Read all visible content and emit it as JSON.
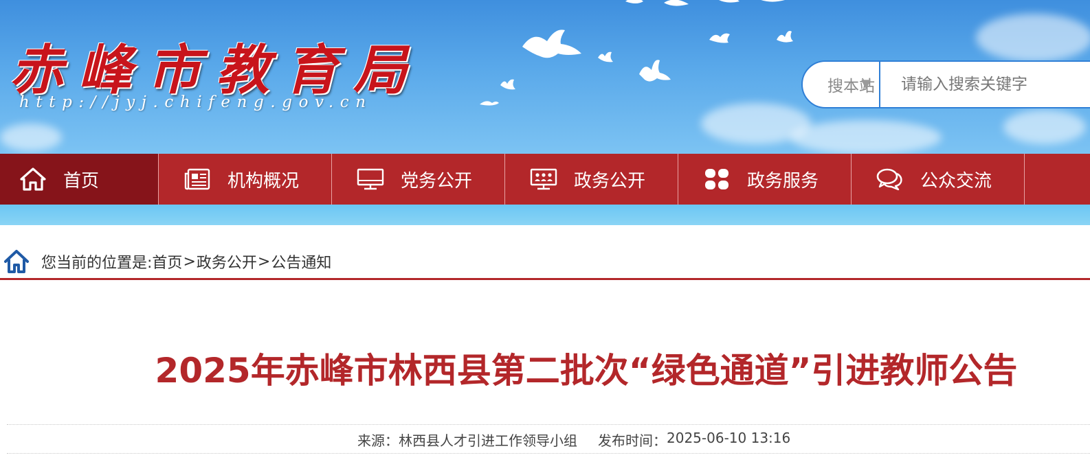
{
  "header": {
    "site_title": "赤峰市教育局",
    "site_url": "http://jyj.chifeng.gov.cn"
  },
  "search": {
    "scope_label": "搜本站",
    "placeholder": "请输入搜索关键字"
  },
  "nav": {
    "items": [
      {
        "label": "首页",
        "icon": "home-icon"
      },
      {
        "label": "机构概况",
        "icon": "newspaper-icon"
      },
      {
        "label": "党务公开",
        "icon": "monitor-icon"
      },
      {
        "label": "政务公开",
        "icon": "meeting-screen-icon"
      },
      {
        "label": "政务服务",
        "icon": "grid-icon"
      },
      {
        "label": "公众交流",
        "icon": "chat-bubbles-icon"
      }
    ]
  },
  "breadcrumb": {
    "prefix": "您当前的位置是:",
    "items": [
      "首页",
      "政务公开",
      "公告通知"
    ],
    "separator": ">"
  },
  "article": {
    "title": "2025年赤峰市林西县第二批次“绿色通道”引进教师公告",
    "source_label": "来源：",
    "source": "林西县人才引进工作领导小组",
    "published_label": "发布时间：",
    "published": "2025-06-10 13:16"
  },
  "colors": {
    "brand_red": "#b3272a",
    "active_nav": "#86141a",
    "sky_blue": "#5aa9ea"
  }
}
